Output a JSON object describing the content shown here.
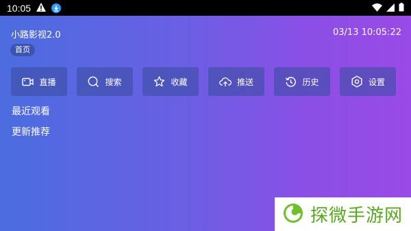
{
  "status_bar": {
    "time": "10:05"
  },
  "app": {
    "title": "小路影视2.0",
    "datetime": "03/13 10:05:22"
  },
  "breadcrumb": "首页",
  "toolbar": [
    {
      "label": "直播",
      "icon": "video-camera-icon"
    },
    {
      "label": "搜索",
      "icon": "search-icon"
    },
    {
      "label": "收藏",
      "icon": "star-icon"
    },
    {
      "label": "推送",
      "icon": "cloud-upload-icon"
    },
    {
      "label": "历史",
      "icon": "history-icon"
    },
    {
      "label": "设置",
      "icon": "gear-icon"
    }
  ],
  "sections": {
    "recent": "最近观看",
    "updates": "更新推荐"
  },
  "watermark": {
    "text": "探微手游网"
  }
}
